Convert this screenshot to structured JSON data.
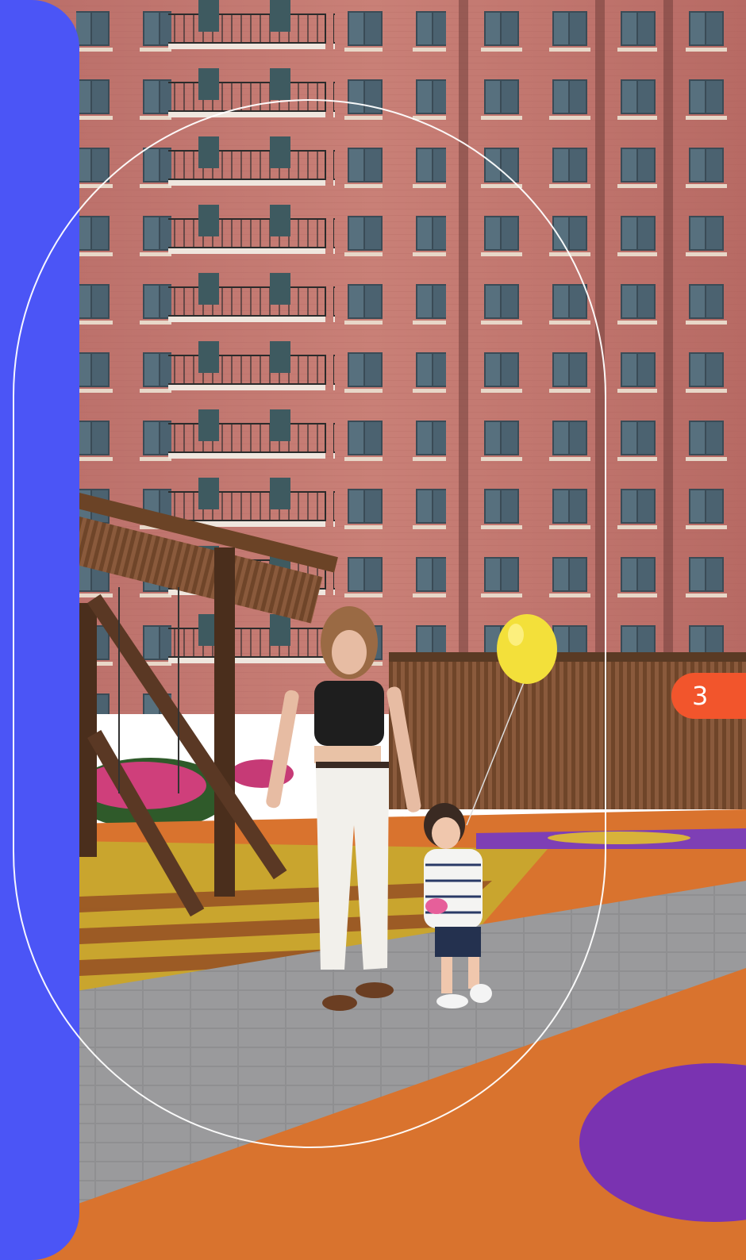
{
  "badge": {
    "counter": "3"
  },
  "colors": {
    "panel_blue": "#4b55f6",
    "badge_orange": "#f2552c",
    "outline_white": "#ffffff"
  }
}
